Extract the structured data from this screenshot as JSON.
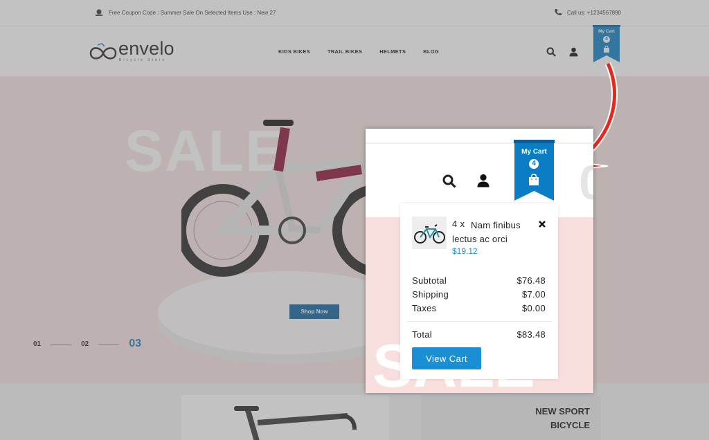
{
  "topbar": {
    "coupon_text": "Free Coupon Code : Summer Sale On Selected Items Use : New 27",
    "call_text": "Call us: +1234567890"
  },
  "brand": {
    "name": "envelo",
    "tagline": "Bicycle Store"
  },
  "nav": {
    "items": [
      {
        "label": "KIDS BIKES"
      },
      {
        "label": "TRAIL BIKES"
      },
      {
        "label": "HELMETS"
      },
      {
        "label": "BLOG"
      }
    ]
  },
  "cart": {
    "label": "My Cart",
    "count": "4"
  },
  "hero": {
    "sale_text": "SALE",
    "shop_button": "Shop Now",
    "slides": [
      "01",
      "02",
      "03"
    ],
    "active_slide": "03"
  },
  "promo": {
    "title_line1": "NEW SPORT",
    "title_line2": "BICYCLE"
  },
  "zoom": {
    "ghost_number": "0"
  },
  "dropdown": {
    "item": {
      "qty": "4 x",
      "name": "Nam finibus lectus ac orci",
      "price": "$19.12"
    },
    "subtotal_label": "Subtotal",
    "subtotal_value": "$76.48",
    "shipping_label": "Shipping",
    "shipping_value": "$7.00",
    "taxes_label": "Taxes",
    "taxes_value": "$0.00",
    "total_label": "Total",
    "total_value": "$83.48",
    "view_cart_label": "View Cart"
  },
  "colors": {
    "accent": "#1a8fd6",
    "ribbon": "#0a7dc4",
    "hero_bg": "#f6e3e2",
    "arrow": "#e8281c"
  }
}
